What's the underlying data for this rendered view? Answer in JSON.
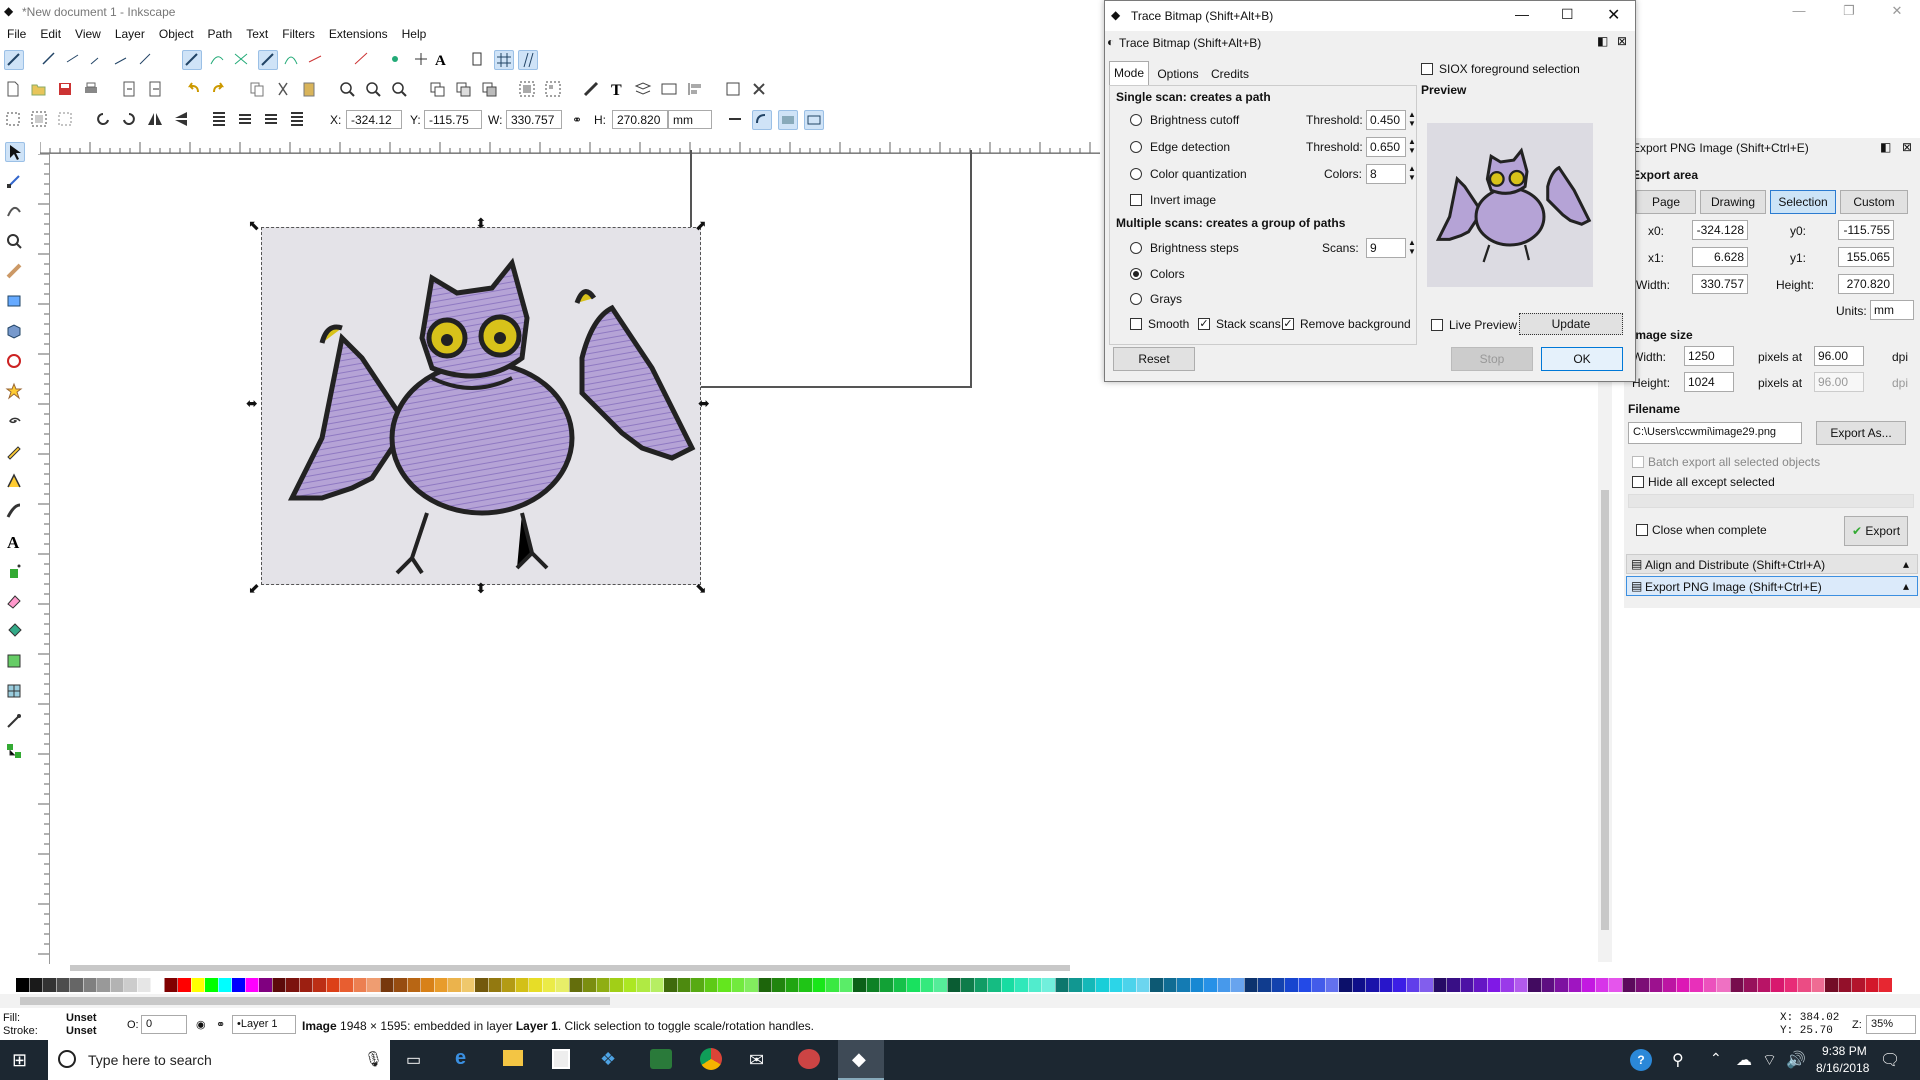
{
  "window": {
    "title": "*New document 1 - Inkscape",
    "min": "—",
    "max": "❐",
    "close": "✕"
  },
  "menu": [
    "File",
    "Edit",
    "View",
    "Layer",
    "Object",
    "Path",
    "Text",
    "Filters",
    "Extensions",
    "Help"
  ],
  "toolbar3": {
    "x_label": "X:",
    "x": "-324.12",
    "y_label": "Y:",
    "y": "-115.75",
    "w_label": "W:",
    "w": "330.757",
    "h_label": "H:",
    "h": "270.820",
    "unit": "mm"
  },
  "trace": {
    "title": "Trace Bitmap (Shift+Alt+B)",
    "subtitle": "Trace Bitmap (Shift+Alt+B)",
    "tabs": [
      "Mode",
      "Options",
      "Credits"
    ],
    "single_title": "Single scan: creates a path",
    "brightness": "Brightness cutoff",
    "thr_label": "Threshold:",
    "thr1": "0.450",
    "edge": "Edge detection",
    "thr2": "0.650",
    "colorq": "Color quantization",
    "colors_label": "Colors:",
    "colors": "8",
    "invert": "Invert image",
    "multi_title": "Multiple scans: creates a group of paths",
    "bsteps": "Brightness steps",
    "scans_label": "Scans:",
    "scans": "9",
    "colorsopt": "Colors",
    "grays": "Grays",
    "smooth": "Smooth",
    "stack": "Stack scans",
    "removebg": "Remove background",
    "siox": "SIOX foreground selection",
    "preview": "Preview",
    "live": "Live Preview",
    "update": "Update",
    "reset": "Reset",
    "stop": "Stop",
    "ok": "OK"
  },
  "export": {
    "title": "Export PNG Image (Shift+Ctrl+E)",
    "area": "Export area",
    "tabs": [
      "Page",
      "Drawing",
      "Selection",
      "Custom"
    ],
    "x0_label": "x0:",
    "x0": "-324.128",
    "y0_label": "y0:",
    "y0": "-115.755",
    "x1_label": "x1:",
    "x1": "6.628",
    "y1_label": "y1:",
    "y1": "155.065",
    "w_label": "Width:",
    "w": "330.757",
    "h_label": "Height:",
    "h": "270.820",
    "units_label": "Units:",
    "units": "mm",
    "imgsize": "Image size",
    "iw_label": "Width:",
    "iw": "1250",
    "pix": "pixels at",
    "dpi1": "96.00",
    "dpi": "dpi",
    "ih_label": "Height:",
    "ih": "1024",
    "dpi2": "96.00",
    "filename_label": "Filename",
    "filename": "C:\\Users\\ccwmi\\image29.png",
    "exportas": "Export As...",
    "batch": "Batch export all selected objects",
    "hideall": "Hide all except selected",
    "close_when": "Close when complete",
    "export_btn": "Export",
    "dock1": "Align and Distribute (Shift+Ctrl+A)",
    "dock2": "Export PNG Image (Shift+Ctrl+E)"
  },
  "status": {
    "fill_label": "Fill:",
    "fill": "Unset",
    "stroke_label": "Stroke:",
    "stroke": "Unset",
    "o_label": "O:",
    "o": "0",
    "layer": "•Layer 1",
    "msg_bold": "Image",
    "msg": " 1948 × 1595: embedded in layer ",
    "msg_layer": "Layer 1",
    "msg2": ". Click selection to toggle scale/rotation handles.",
    "coord_x": "X:  384.02",
    "coord_y": "Y:   25.70",
    "z_label": "Z:",
    "zoom": "35%"
  },
  "taskbar": {
    "search": "Type here to search",
    "time": "9:38 PM",
    "date": "8/16/2018"
  }
}
